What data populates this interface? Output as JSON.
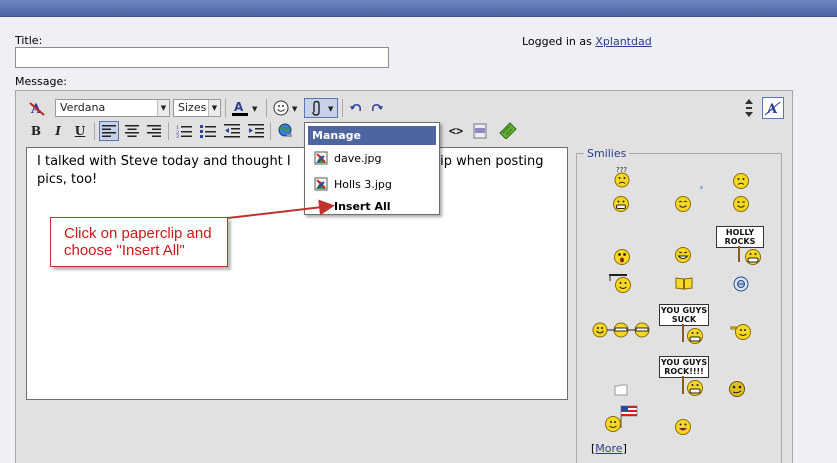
{
  "form": {
    "title_label": "Title:",
    "title_value": "",
    "message_label": "Message:",
    "logged_in_prefix": "Logged in as",
    "username": "Xplantdad"
  },
  "toolbar": {
    "font_name": "Verdana",
    "font_size": "Sizes",
    "bold": "B",
    "italic": "I",
    "underline": "U",
    "code": "<>"
  },
  "editor": {
    "line1_a": "I talked with Steve today and thought I",
    "line1_b": "tip when posting",
    "line2": "pics, too!"
  },
  "attachments_menu": {
    "header": "Manage Attachments",
    "items": [
      "dave.jpg",
      "Holls 3.jpg"
    ],
    "insert_all": "Insert All"
  },
  "callout": {
    "line1": "Click on paperclip and",
    "line2": "choose \"Insert All\""
  },
  "smilies": {
    "legend": "Smilies",
    "sign_holly": [
      "HOLLY",
      "ROCKS"
    ],
    "sign_suck": [
      "YOU GUYS",
      "SUCK"
    ],
    "sign_rock": [
      "YOU GUYS",
      "ROCK!!!!"
    ],
    "more_open": "[",
    "more_link": "More",
    "more_close": "]"
  },
  "colors": {
    "accent": "#4f659f",
    "annotation": "#d01818",
    "link": "#2b3b8f"
  }
}
